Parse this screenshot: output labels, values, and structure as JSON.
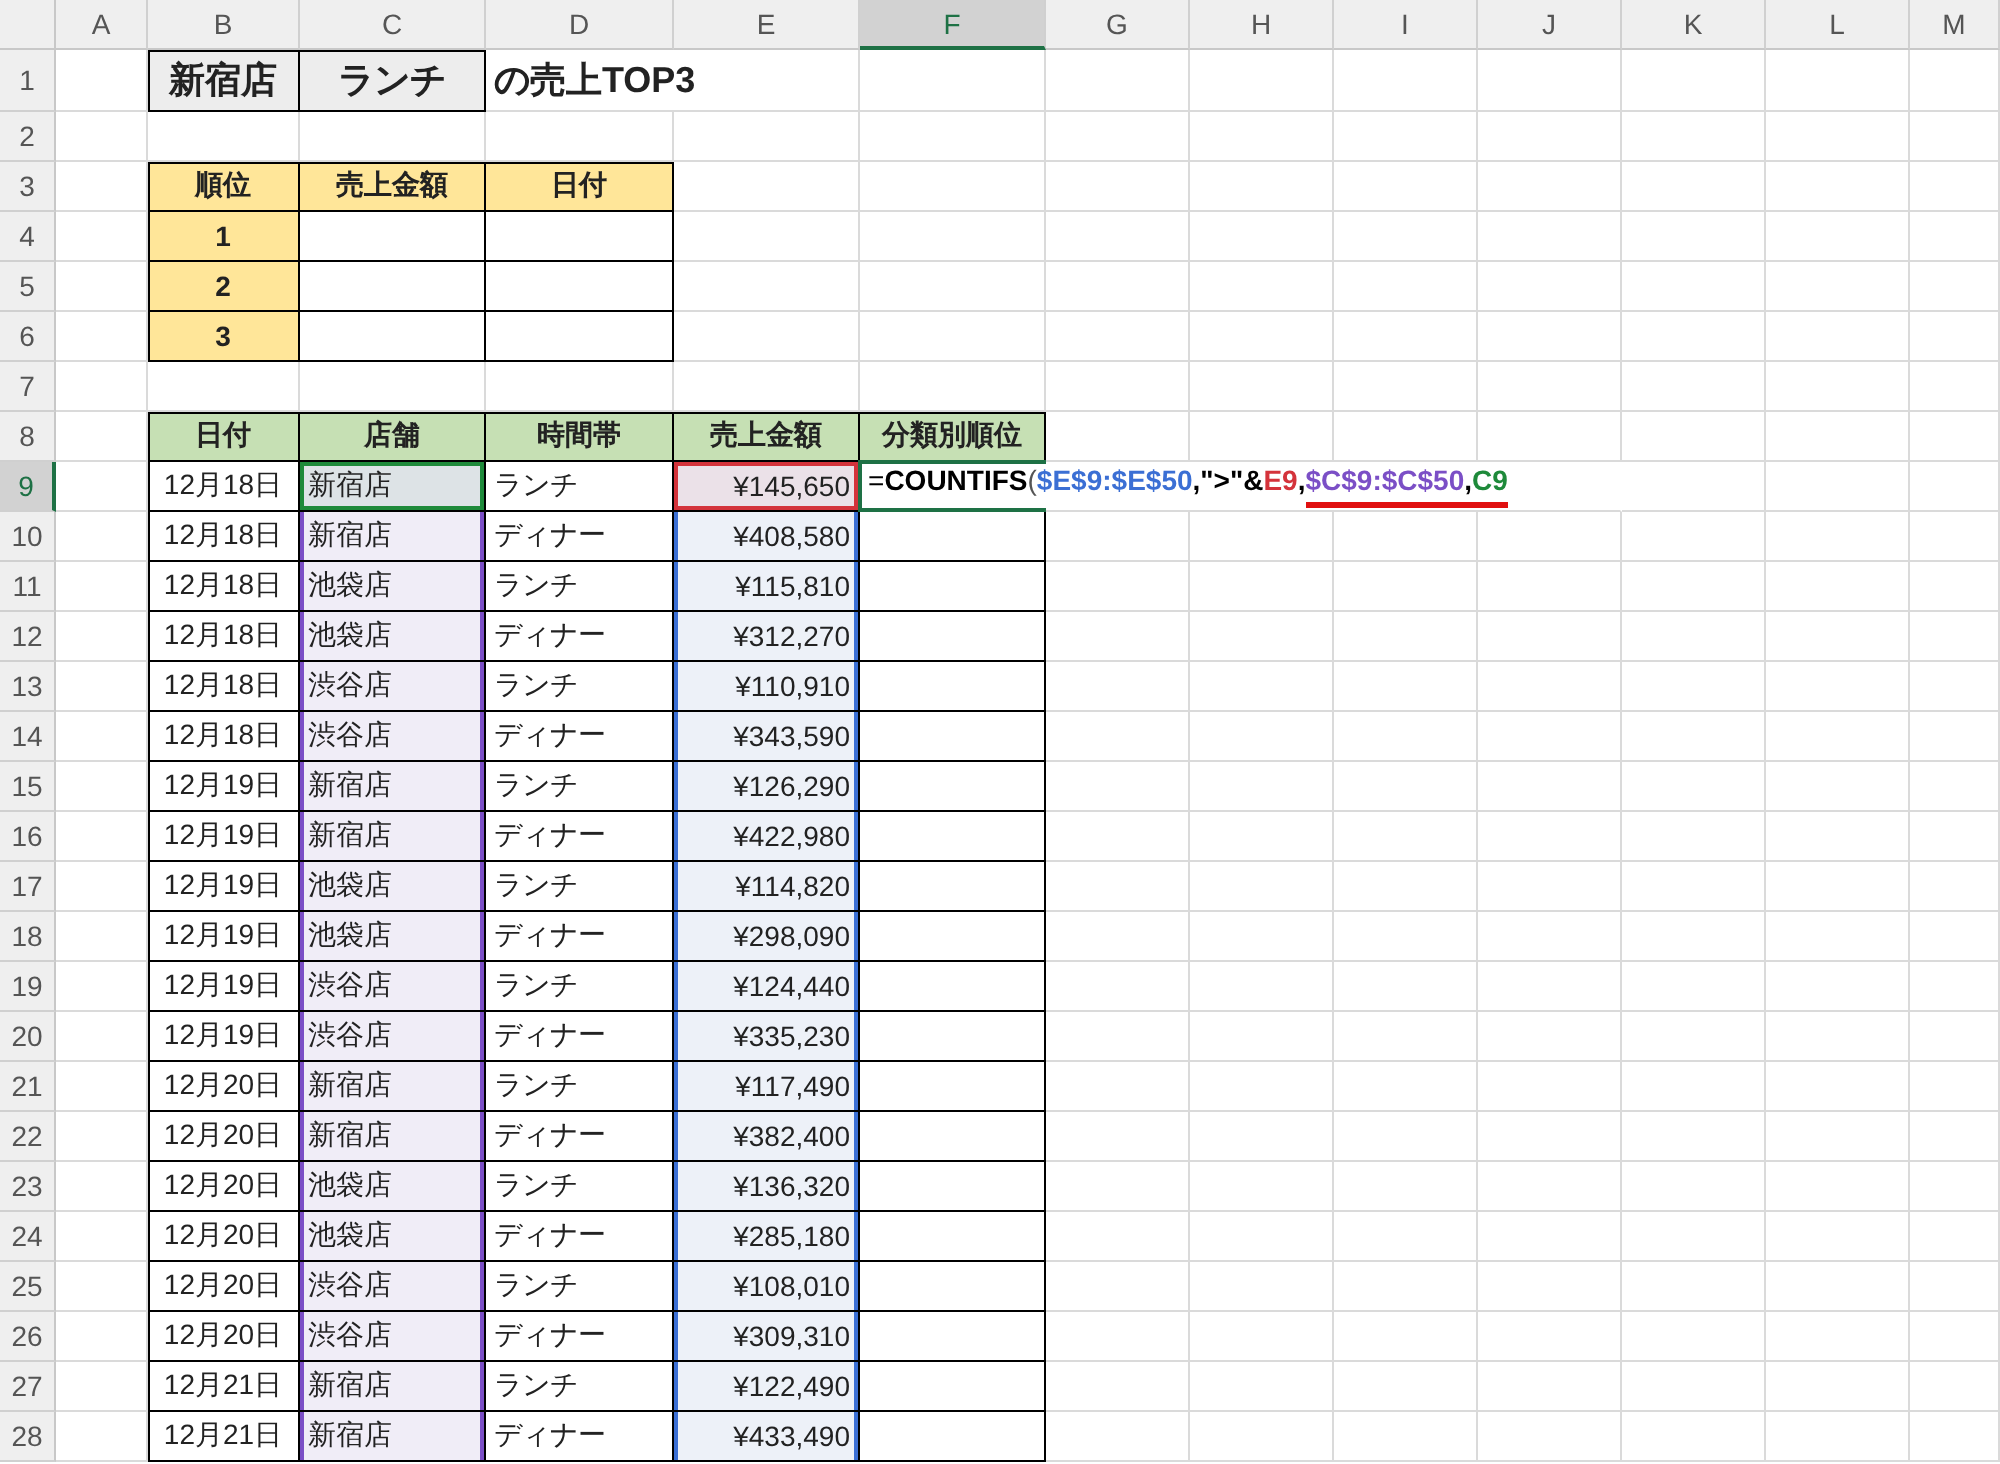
{
  "column_headers": [
    {
      "label": "A",
      "selected": false
    },
    {
      "label": "B",
      "selected": false
    },
    {
      "label": "C",
      "selected": false
    },
    {
      "label": "D",
      "selected": false
    },
    {
      "label": "E",
      "selected": false
    },
    {
      "label": "F",
      "selected": true
    },
    {
      "label": "G",
      "selected": false
    },
    {
      "label": "H",
      "selected": false
    },
    {
      "label": "I",
      "selected": false
    },
    {
      "label": "J",
      "selected": false
    },
    {
      "label": "K",
      "selected": false
    },
    {
      "label": "L",
      "selected": false
    },
    {
      "label": "M",
      "selected": false
    }
  ],
  "row_headers": [
    {
      "label": "1",
      "selected": false
    },
    {
      "label": "2",
      "selected": false
    },
    {
      "label": "3",
      "selected": false
    },
    {
      "label": "4",
      "selected": false
    },
    {
      "label": "5",
      "selected": false
    },
    {
      "label": "6",
      "selected": false
    },
    {
      "label": "7",
      "selected": false
    },
    {
      "label": "8",
      "selected": false
    },
    {
      "label": "9",
      "selected": true
    },
    {
      "label": "10",
      "selected": false
    },
    {
      "label": "11",
      "selected": false
    },
    {
      "label": "12",
      "selected": false
    },
    {
      "label": "13",
      "selected": false
    },
    {
      "label": "14",
      "selected": false
    },
    {
      "label": "15",
      "selected": false
    },
    {
      "label": "16",
      "selected": false
    },
    {
      "label": "17",
      "selected": false
    },
    {
      "label": "18",
      "selected": false
    },
    {
      "label": "19",
      "selected": false
    },
    {
      "label": "20",
      "selected": false
    },
    {
      "label": "21",
      "selected": false
    },
    {
      "label": "22",
      "selected": false
    },
    {
      "label": "23",
      "selected": false
    },
    {
      "label": "24",
      "selected": false
    },
    {
      "label": "25",
      "selected": false
    },
    {
      "label": "26",
      "selected": false
    },
    {
      "label": "27",
      "selected": false
    },
    {
      "label": "28",
      "selected": false
    }
  ],
  "title": {
    "store": "新宿店",
    "period": "ランチ",
    "suffix": "の売上TOP3"
  },
  "top3": {
    "columns": [
      "順位",
      "売上金額",
      "日付"
    ],
    "ranks": [
      "1",
      "2",
      "3"
    ]
  },
  "sales": {
    "columns": [
      "日付",
      "店舗",
      "時間帯",
      "売上金額",
      "分類別順位"
    ],
    "rows": [
      {
        "date": "12月18日",
        "store": "新宿店",
        "period": "ランチ",
        "amount": "¥145,650"
      },
      {
        "date": "12月18日",
        "store": "新宿店",
        "period": "ディナー",
        "amount": "¥408,580"
      },
      {
        "date": "12月18日",
        "store": "池袋店",
        "period": "ランチ",
        "amount": "¥115,810"
      },
      {
        "date": "12月18日",
        "store": "池袋店",
        "period": "ディナー",
        "amount": "¥312,270"
      },
      {
        "date": "12月18日",
        "store": "渋谷店",
        "period": "ランチ",
        "amount": "¥110,910"
      },
      {
        "date": "12月18日",
        "store": "渋谷店",
        "period": "ディナー",
        "amount": "¥343,590"
      },
      {
        "date": "12月19日",
        "store": "新宿店",
        "period": "ランチ",
        "amount": "¥126,290"
      },
      {
        "date": "12月19日",
        "store": "新宿店",
        "period": "ディナー",
        "amount": "¥422,980"
      },
      {
        "date": "12月19日",
        "store": "池袋店",
        "period": "ランチ",
        "amount": "¥114,820"
      },
      {
        "date": "12月19日",
        "store": "池袋店",
        "period": "ディナー",
        "amount": "¥298,090"
      },
      {
        "date": "12月19日",
        "store": "渋谷店",
        "period": "ランチ",
        "amount": "¥124,440"
      },
      {
        "date": "12月19日",
        "store": "渋谷店",
        "period": "ディナー",
        "amount": "¥335,230"
      },
      {
        "date": "12月20日",
        "store": "新宿店",
        "period": "ランチ",
        "amount": "¥117,490"
      },
      {
        "date": "12月20日",
        "store": "新宿店",
        "period": "ディナー",
        "amount": "¥382,400"
      },
      {
        "date": "12月20日",
        "store": "池袋店",
        "period": "ランチ",
        "amount": "¥136,320"
      },
      {
        "date": "12月20日",
        "store": "池袋店",
        "period": "ディナー",
        "amount": "¥285,180"
      },
      {
        "date": "12月20日",
        "store": "渋谷店",
        "period": "ランチ",
        "amount": "¥108,010"
      },
      {
        "date": "12月20日",
        "store": "渋谷店",
        "period": "ディナー",
        "amount": "¥309,310"
      },
      {
        "date": "12月21日",
        "store": "新宿店",
        "period": "ランチ",
        "amount": "¥122,490"
      },
      {
        "date": "12月21日",
        "store": "新宿店",
        "period": "ディナー",
        "amount": "¥433,490"
      }
    ],
    "formula": [
      {
        "text": "=",
        "color": "#000000",
        "bold": false,
        "underlined": false
      },
      {
        "text": "COUNTIFS",
        "color": "#000000",
        "bold": true,
        "underlined": false
      },
      {
        "text": "(",
        "color": "#555555",
        "bold": false,
        "underlined": false
      },
      {
        "text": "$E$9:$E$50",
        "color": "#3b6fd4",
        "bold": true,
        "underlined": false
      },
      {
        "text": ",\">\"&",
        "color": "#000000",
        "bold": true,
        "underlined": false
      },
      {
        "text": "E9",
        "color": "#d4333b",
        "bold": true,
        "underlined": false
      },
      {
        "text": ",",
        "color": "#000000",
        "bold": true,
        "underlined": false
      },
      {
        "text": "$C$9:$C$50",
        "color": "#7b4fc6",
        "bold": true,
        "underlined": true
      },
      {
        "text": ",",
        "color": "#000000",
        "bold": true,
        "underlined": true
      },
      {
        "text": "C9",
        "color": "#1e8a3a",
        "bold": true,
        "underlined": true
      }
    ]
  }
}
